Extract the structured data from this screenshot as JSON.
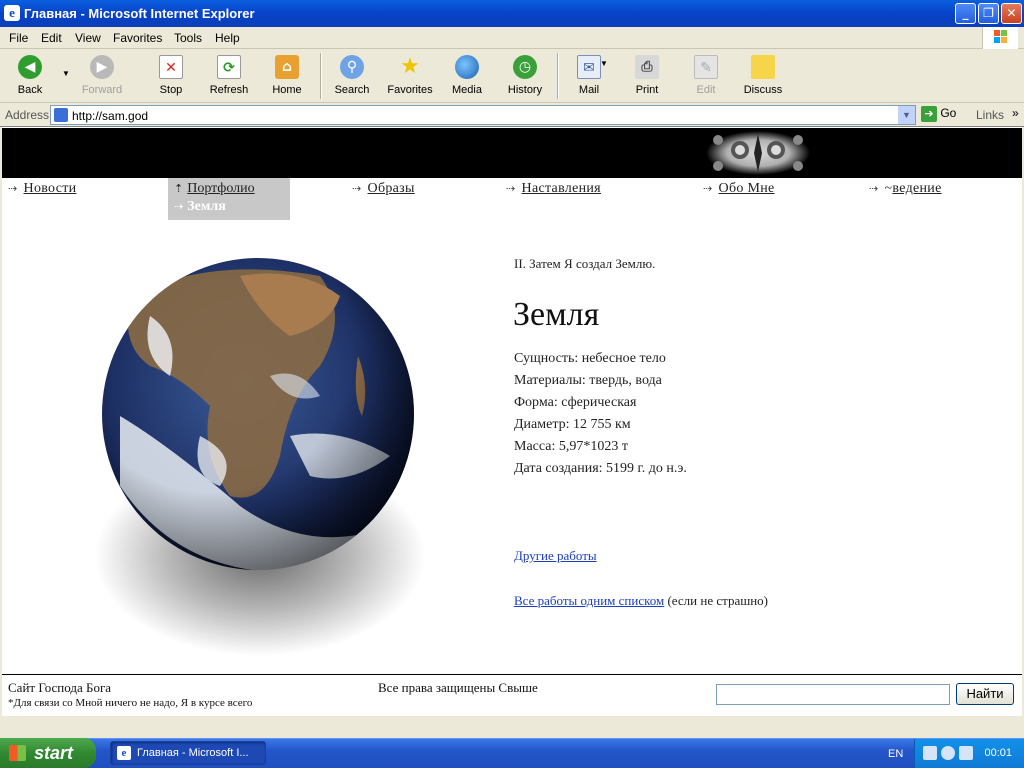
{
  "window": {
    "title": "Главная - Microsoft Internet Explorer",
    "controls": {
      "minimize": "_",
      "maximize": "❐",
      "close": "✕"
    }
  },
  "menu": [
    "File",
    "Edit",
    "View",
    "Favorites",
    "Tools",
    "Help"
  ],
  "toolbar": {
    "back": "Back",
    "forward": "Forward",
    "stop": "Stop",
    "refresh": "Refresh",
    "home": "Home",
    "search": "Search",
    "favorites": "Favorites",
    "media": "Media",
    "history": "History",
    "mail": "Mail",
    "print": "Print",
    "edit": "Edit",
    "discuss": "Discuss"
  },
  "address": {
    "label": "Address",
    "url": "http://sam.god",
    "go": "Go",
    "links": "Links"
  },
  "nav": {
    "news": "Новости",
    "portfolio": "Портфолио",
    "portfolio_current": "Земля",
    "images": "Образы",
    "teachings": "Наставления",
    "about": "Обо Мне",
    "intro_prefix": "~",
    "intro": "ведение"
  },
  "content": {
    "subtitle": "II. Затем Я создал Землю.",
    "title": "Земля",
    "properties": [
      "Сущность: небесное тело",
      "Материалы: твердь, вода",
      "Форма: сферическая",
      "Диаметр: 12 755 км",
      "Масса: 5,97*1023 т",
      "Дата создания: 5199 г. до н.э."
    ],
    "other_works": "Другие работы",
    "all_works_link": "Все работы одним списком",
    "all_works_note": " (если не страшно)"
  },
  "footer": {
    "site": "Сайт Господа Бога",
    "note": "*Для связи со Мной ничего не надо, Я в курсе всего",
    "rights": "Все права защищены Свыше",
    "search_placeholder": "",
    "search_button": "Найти"
  },
  "taskbar": {
    "start": "start",
    "task": "Главная - Microsoft I...",
    "lang": "EN",
    "clock": "00:01"
  }
}
